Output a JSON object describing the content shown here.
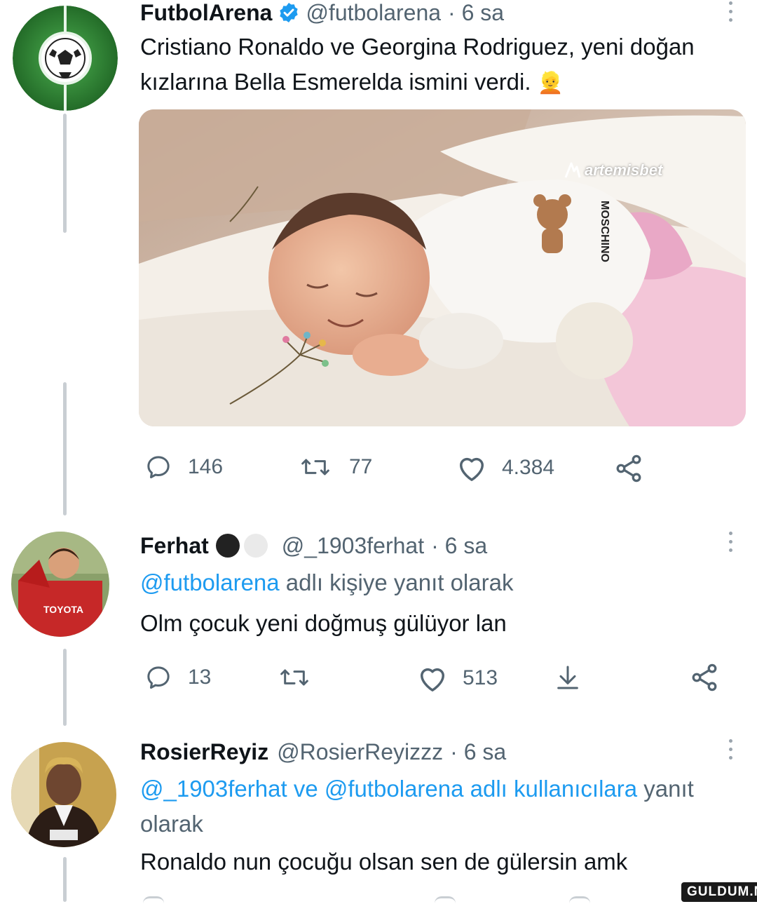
{
  "tweet1": {
    "name": "FutbolArena",
    "handle": "@futbolarena",
    "time": "· 6 sa",
    "text_line1": "Cristiano Ronaldo ve Georgina Rodriguez, yeni doğan",
    "text_line2": "kızlarına Bella Esmerelda ismini verdi.",
    "emoji": "👱",
    "watermark": "artemisbet",
    "moschino": "MOSCHINO",
    "replies": "146",
    "retweets": "77",
    "likes": "4.384"
  },
  "tweet2": {
    "name": "Ferhat",
    "handle": "@_1903ferhat",
    "time": "· 6 sa",
    "reply_to_handle": "@futbolarena",
    "reply_to_suffix": " adlı kişiye yanıt olarak",
    "text": "Olm çocuk yeni doğmuş gülüyor lan",
    "jersey": "TOYOTA",
    "replies": "13",
    "likes": "513"
  },
  "tweet3": {
    "name": "RosierReyiz",
    "handle": "@RosierReyizzz",
    "time": "· 6 sa",
    "reply_to_link": "@_1903ferhat ve @futbolarena adlı kullanıcılara",
    "reply_to_suffix": " yanıt",
    "reply_to_line2": "olarak",
    "text": "Ronaldo nun çocuğu olsan sen de gülersin amk"
  },
  "footer_watermark": "GULDUM.NET",
  "colors": {
    "link": "#1d9bf0",
    "muted": "#536471",
    "verified": "#1d9bf0"
  }
}
